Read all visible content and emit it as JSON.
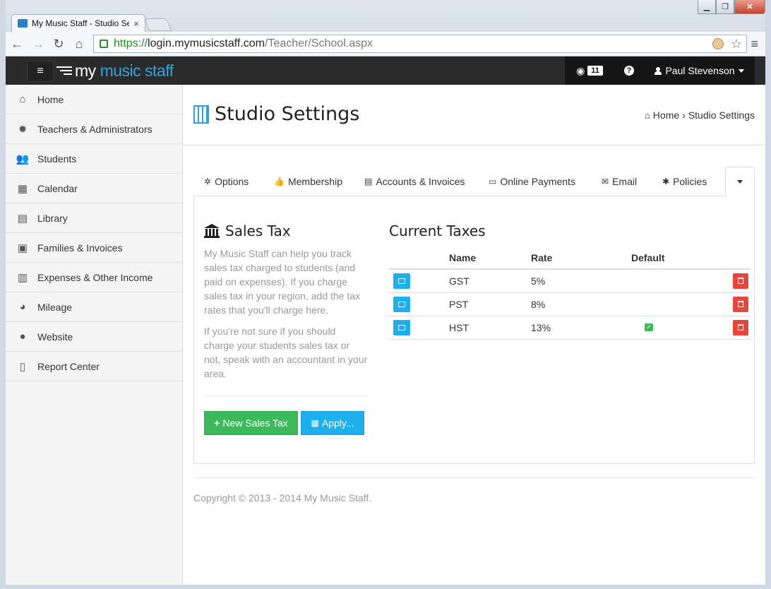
{
  "browser": {
    "tab_title": "My Music Staff - Studio Se",
    "tab_close": "×",
    "url_https": "https://",
    "url_domain": "login.mymusicstaff.com",
    "url_path": "/Teacher/School.aspx",
    "window_min": "▁",
    "window_max": "❐",
    "window_close": "✕"
  },
  "navbar": {
    "logo_prefix": "my ",
    "logo_accent": "music staff",
    "rss_count": "11",
    "help_label": "?",
    "user_name": "Paul Stevenson"
  },
  "sidebar": {
    "items": [
      {
        "label": "Home",
        "icon": "home-icon"
      },
      {
        "label": "Teachers & Administrators",
        "icon": "gear-icon"
      },
      {
        "label": "Students",
        "icon": "users-icon"
      },
      {
        "label": "Calendar",
        "icon": "calendar-icon"
      },
      {
        "label": "Library",
        "icon": "book-icon"
      },
      {
        "label": "Families & Invoices",
        "icon": "money-icon"
      },
      {
        "label": "Expenses & Other Income",
        "icon": "bar-chart-icon"
      },
      {
        "label": "Mileage",
        "icon": "dashboard-icon"
      },
      {
        "label": "Website",
        "icon": "globe-icon"
      },
      {
        "label": "Report Center",
        "icon": "document-icon"
      }
    ]
  },
  "page": {
    "title": "Studio Settings",
    "breadcrumb_home": "Home",
    "breadcrumb_sep": "›",
    "breadcrumb_current": "Studio Settings"
  },
  "tabs": [
    {
      "label": "Options",
      "icon": "cog-icon"
    },
    {
      "label": "Membership",
      "icon": "thumbs-up-icon"
    },
    {
      "label": "Accounts & Invoices",
      "icon": "file-icon"
    },
    {
      "label": "Online Payments",
      "icon": "credit-card-icon"
    },
    {
      "label": "Email",
      "icon": "envelope-icon"
    },
    {
      "label": "Policies",
      "icon": "asterisk-icon"
    }
  ],
  "sales_tax": {
    "title": "Sales Tax",
    "desc1": "My Music Staff can help you track sales tax charged to students (and paid on expenses). If you charge sales tax in your region, add the tax rates that you'll charge here.",
    "desc2": "If you're not sure if you should charge your students sales tax or not, speak with an accountant in your area.",
    "new_button": "New Sales Tax",
    "apply_button": "Apply..."
  },
  "current_taxes": {
    "title": "Current Taxes",
    "headers": {
      "name": "Name",
      "rate": "Rate",
      "default": "Default"
    },
    "rows": [
      {
        "name": "GST",
        "rate": "5%",
        "default": false
      },
      {
        "name": "PST",
        "rate": "8%",
        "default": false
      },
      {
        "name": "HST",
        "rate": "13%",
        "default": true
      }
    ]
  },
  "footer": {
    "copyright": "Copyright © 2013 - 2014 My Music Staff."
  },
  "colors": {
    "accent": "#31a3dc",
    "success": "#3cb95a",
    "danger": "#e8453c",
    "navbar": "#2b2b2b"
  }
}
